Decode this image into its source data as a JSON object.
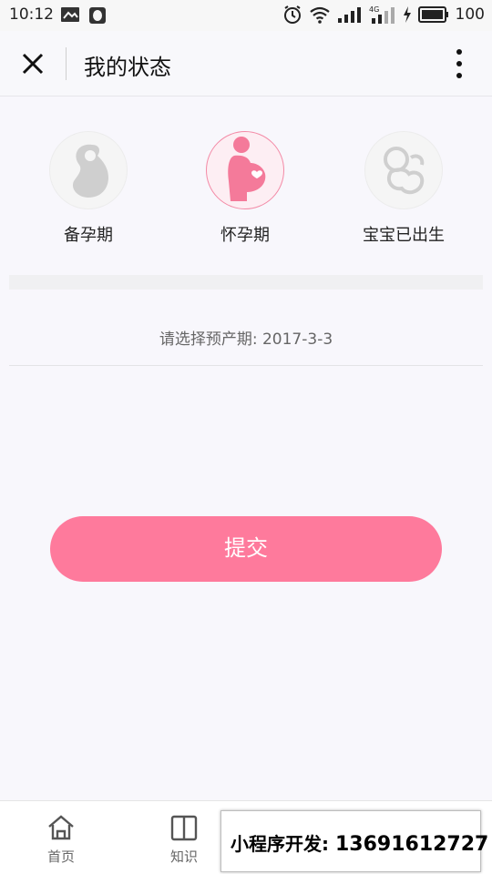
{
  "status_bar": {
    "time": "10:12",
    "battery": "100",
    "network": "4G"
  },
  "nav": {
    "title": "我的状态"
  },
  "stages": [
    {
      "label": "备孕期",
      "icon": "pregnancy-prep-icon",
      "selected": false
    },
    {
      "label": "怀孕期",
      "icon": "pregnant-woman-icon",
      "selected": true
    },
    {
      "label": "宝宝已出生",
      "icon": "baby-icon",
      "selected": false
    }
  ],
  "due_date": {
    "prefix": "请选择预产期: ",
    "value": "2017-3-3"
  },
  "submit": {
    "label": "提交"
  },
  "tabs": [
    {
      "label": "首页",
      "icon": "home-icon"
    },
    {
      "label": "知识",
      "icon": "book-icon"
    }
  ],
  "promo": {
    "label": "小程序开发: ",
    "phone": "13691612727"
  },
  "colors": {
    "accent": "#fe7a9c",
    "inactive": "#cfcfcf",
    "background": "#f8f7fc"
  }
}
